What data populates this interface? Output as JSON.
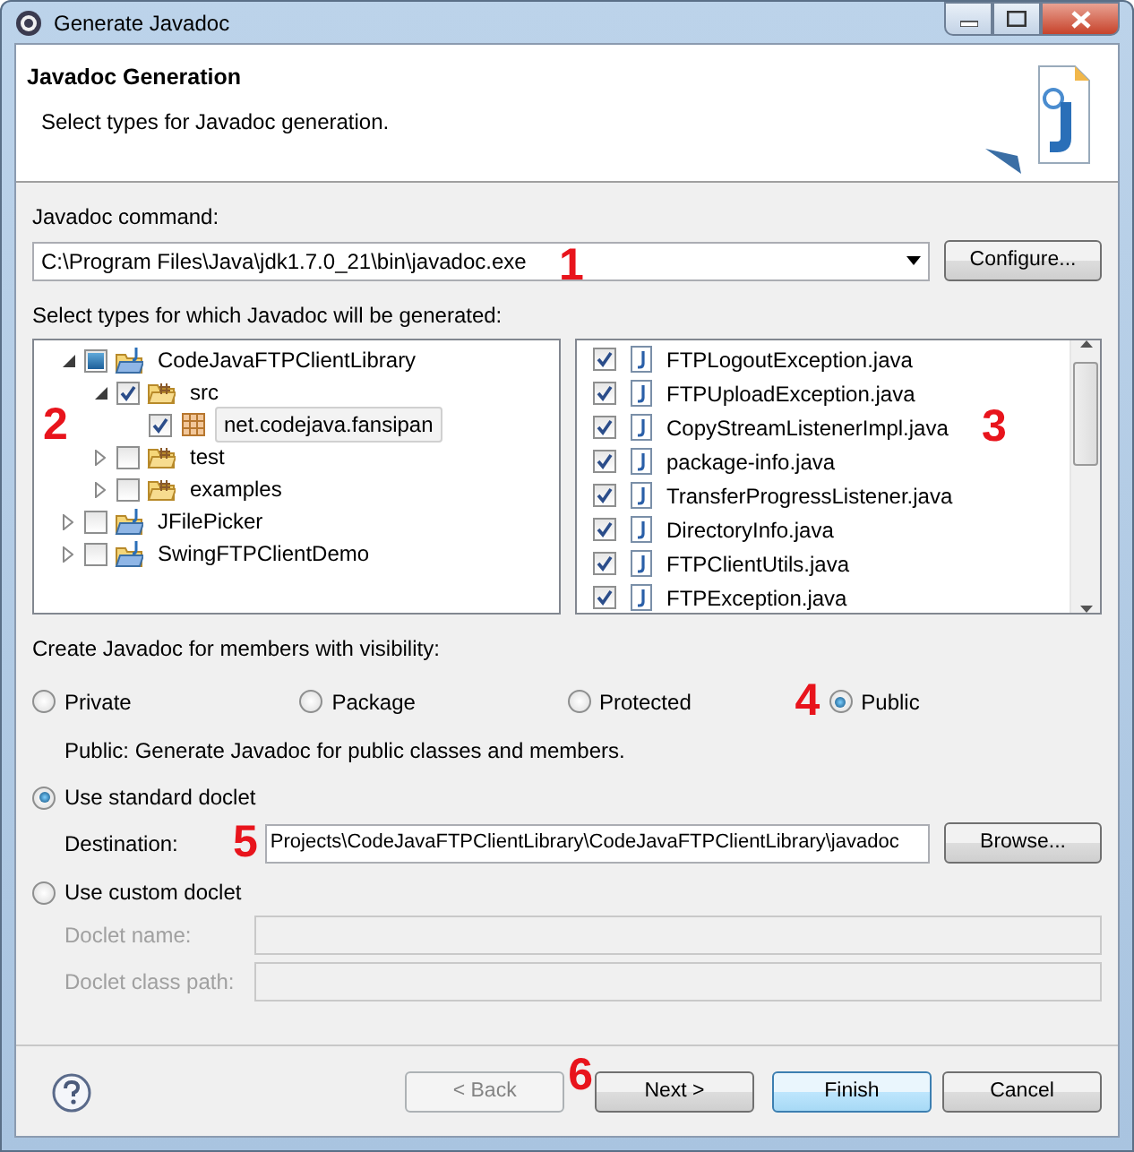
{
  "window": {
    "title": "Generate Javadoc"
  },
  "header": {
    "title": "Javadoc Generation",
    "message": "Select types for Javadoc generation."
  },
  "command": {
    "label": "Javadoc command:",
    "value": "C:\\Program Files\\Java\\jdk1.7.0_21\\bin\\javadoc.exe",
    "button": "Configure...",
    "marker": "1"
  },
  "types_label": "Select types for which Javadoc will be generated:",
  "tree": {
    "marker": "2",
    "items": [
      {
        "label": "CodeJavaFTPClientLibrary",
        "kind": "project",
        "checked": true,
        "partial": true,
        "expanded": true,
        "selected": false,
        "children": [
          {
            "label": "src",
            "kind": "source-folder",
            "checked": true,
            "partial": false,
            "expanded": true,
            "selected": false,
            "children": [
              {
                "label": "net.codejava.fansipan",
                "kind": "package",
                "checked": true,
                "partial": false,
                "selected": true
              }
            ]
          },
          {
            "label": "test",
            "kind": "source-folder",
            "checked": false,
            "partial": false,
            "expanded": false,
            "selected": false
          },
          {
            "label": "examples",
            "kind": "source-folder",
            "checked": false,
            "partial": false,
            "expanded": false,
            "selected": false
          }
        ]
      },
      {
        "label": "JFilePicker",
        "kind": "project",
        "checked": false,
        "partial": false,
        "expanded": false,
        "selected": false
      },
      {
        "label": "SwingFTPClientDemo",
        "kind": "project",
        "checked": false,
        "partial": false,
        "expanded": false,
        "selected": false
      }
    ]
  },
  "files": {
    "marker": "3",
    "items": [
      {
        "label": "FTPLogoutException.java",
        "checked": true
      },
      {
        "label": "FTPUploadException.java",
        "checked": true
      },
      {
        "label": "CopyStreamListenerImpl.java",
        "checked": true
      },
      {
        "label": "package-info.java",
        "checked": true
      },
      {
        "label": "TransferProgressListener.java",
        "checked": true
      },
      {
        "label": "DirectoryInfo.java",
        "checked": true
      },
      {
        "label": "FTPClientUtils.java",
        "checked": true
      },
      {
        "label": "FTPException.java",
        "checked": true
      }
    ]
  },
  "visibility": {
    "label": "Create Javadoc for members with visibility:",
    "marker": "4",
    "options": [
      {
        "label": "Private",
        "selected": false
      },
      {
        "label": "Package",
        "selected": false
      },
      {
        "label": "Protected",
        "selected": false
      },
      {
        "label": "Public",
        "selected": true
      }
    ],
    "description": "Public: Generate Javadoc for public classes and members."
  },
  "standard_doclet": {
    "label": "Use standard doclet",
    "selected": true,
    "destination_label": "Destination:",
    "destination": "Projects\\CodeJavaFTPClientLibrary\\CodeJavaFTPClientLibrary\\javadoc",
    "button": "Browse...",
    "marker": "5"
  },
  "custom_doclet": {
    "label": "Use custom doclet",
    "selected": false,
    "fields": [
      {
        "label": "Doclet name:",
        "disabled": true
      },
      {
        "label": "Doclet class path:",
        "disabled": true
      }
    ]
  },
  "buttons": [
    {
      "label": "< Back",
      "disabled": true,
      "default": false
    },
    {
      "label": "Next >",
      "disabled": false,
      "default": false,
      "marker": "6"
    },
    {
      "label": "Finish",
      "disabled": false,
      "default": true
    },
    {
      "label": "Cancel",
      "disabled": false,
      "default": false
    }
  ]
}
